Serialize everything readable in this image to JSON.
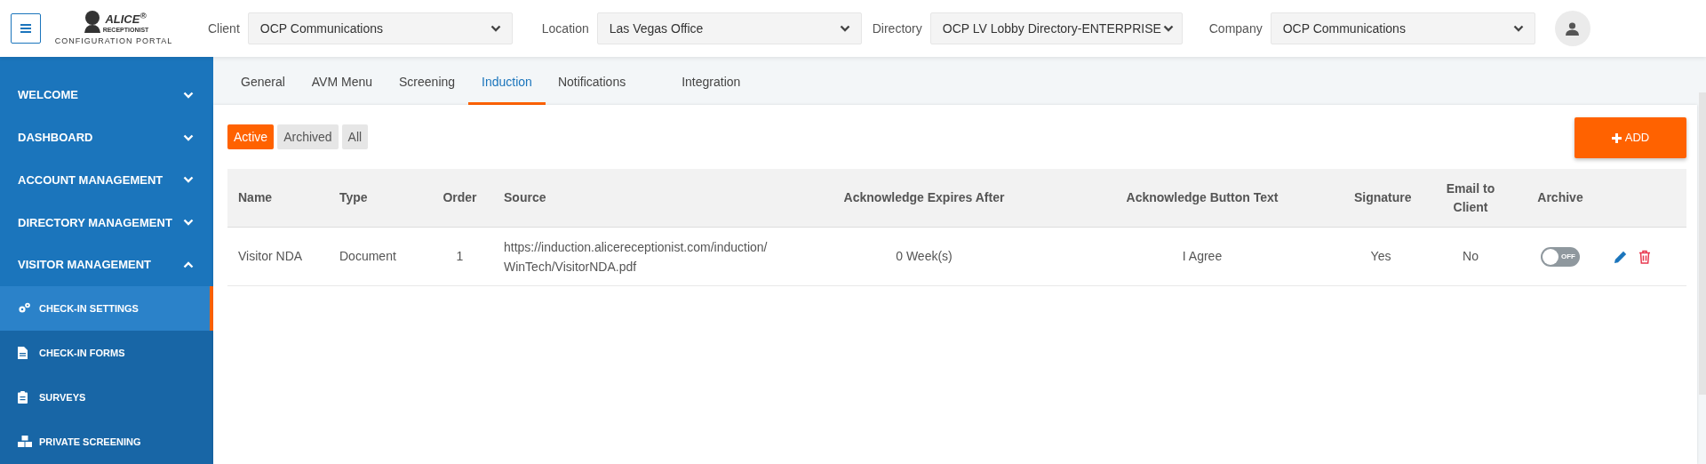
{
  "header": {
    "logo": {
      "brand": "ALICE$^{®}$",
      "sub": "RECEPTIONIST",
      "tagline": "CONFIGURATION PORTAL"
    },
    "filters": [
      {
        "label": "Client",
        "value": "OCP Communications"
      },
      {
        "label": "Location",
        "value": "Las Vegas Office"
      },
      {
        "label": "Directory",
        "value": "OCP LV Lobby Directory-ENTERPRISE"
      },
      {
        "label": "Company",
        "value": "OCP Communications"
      }
    ]
  },
  "sidebar": {
    "items": [
      {
        "label": "WELCOME",
        "expanded": false
      },
      {
        "label": "DASHBOARD",
        "expanded": false
      },
      {
        "label": "ACCOUNT MANAGEMENT",
        "expanded": false
      },
      {
        "label": "DIRECTORY MANAGEMENT",
        "expanded": false
      },
      {
        "label": "VISITOR MANAGEMENT",
        "expanded": true,
        "children": [
          {
            "label": "CHECK-IN SETTINGS",
            "selected": true
          },
          {
            "label": "CHECK-IN FORMS",
            "selected": false
          },
          {
            "label": "SURVEYS",
            "selected": false
          },
          {
            "label": "PRIVATE SCREENING",
            "selected": false
          }
        ]
      }
    ]
  },
  "tabs": [
    {
      "label": "General",
      "selected": false
    },
    {
      "label": "AVM Menu",
      "selected": false
    },
    {
      "label": "Screening",
      "selected": false
    },
    {
      "label": "Induction",
      "selected": true
    },
    {
      "label": "Notifications",
      "selected": false
    },
    {
      "label": "Integration",
      "selected": false
    }
  ],
  "filter_buttons": [
    {
      "label": "Active",
      "selected": true
    },
    {
      "label": "Archived",
      "selected": false
    },
    {
      "label": "All",
      "selected": false
    }
  ],
  "add_button": "ADD",
  "table": {
    "columns": [
      "Name",
      "Type",
      "Order",
      "Source",
      "Acknowledge Expires After",
      "Acknowledge Button Text",
      "Signature",
      "Email to Client",
      "Archive"
    ],
    "rows": [
      {
        "name": "Visitor NDA",
        "type": "Document",
        "order": "1",
        "source": "https://induction.alicereceptionist.com/induction/WinTech/VisitorNDA.pdf",
        "expires": "0 Week(s)",
        "button_text": "I Agree",
        "signature": "Yes",
        "email_to_client": "No",
        "archive": {
          "on": false,
          "label": "OFF"
        }
      }
    ]
  }
}
